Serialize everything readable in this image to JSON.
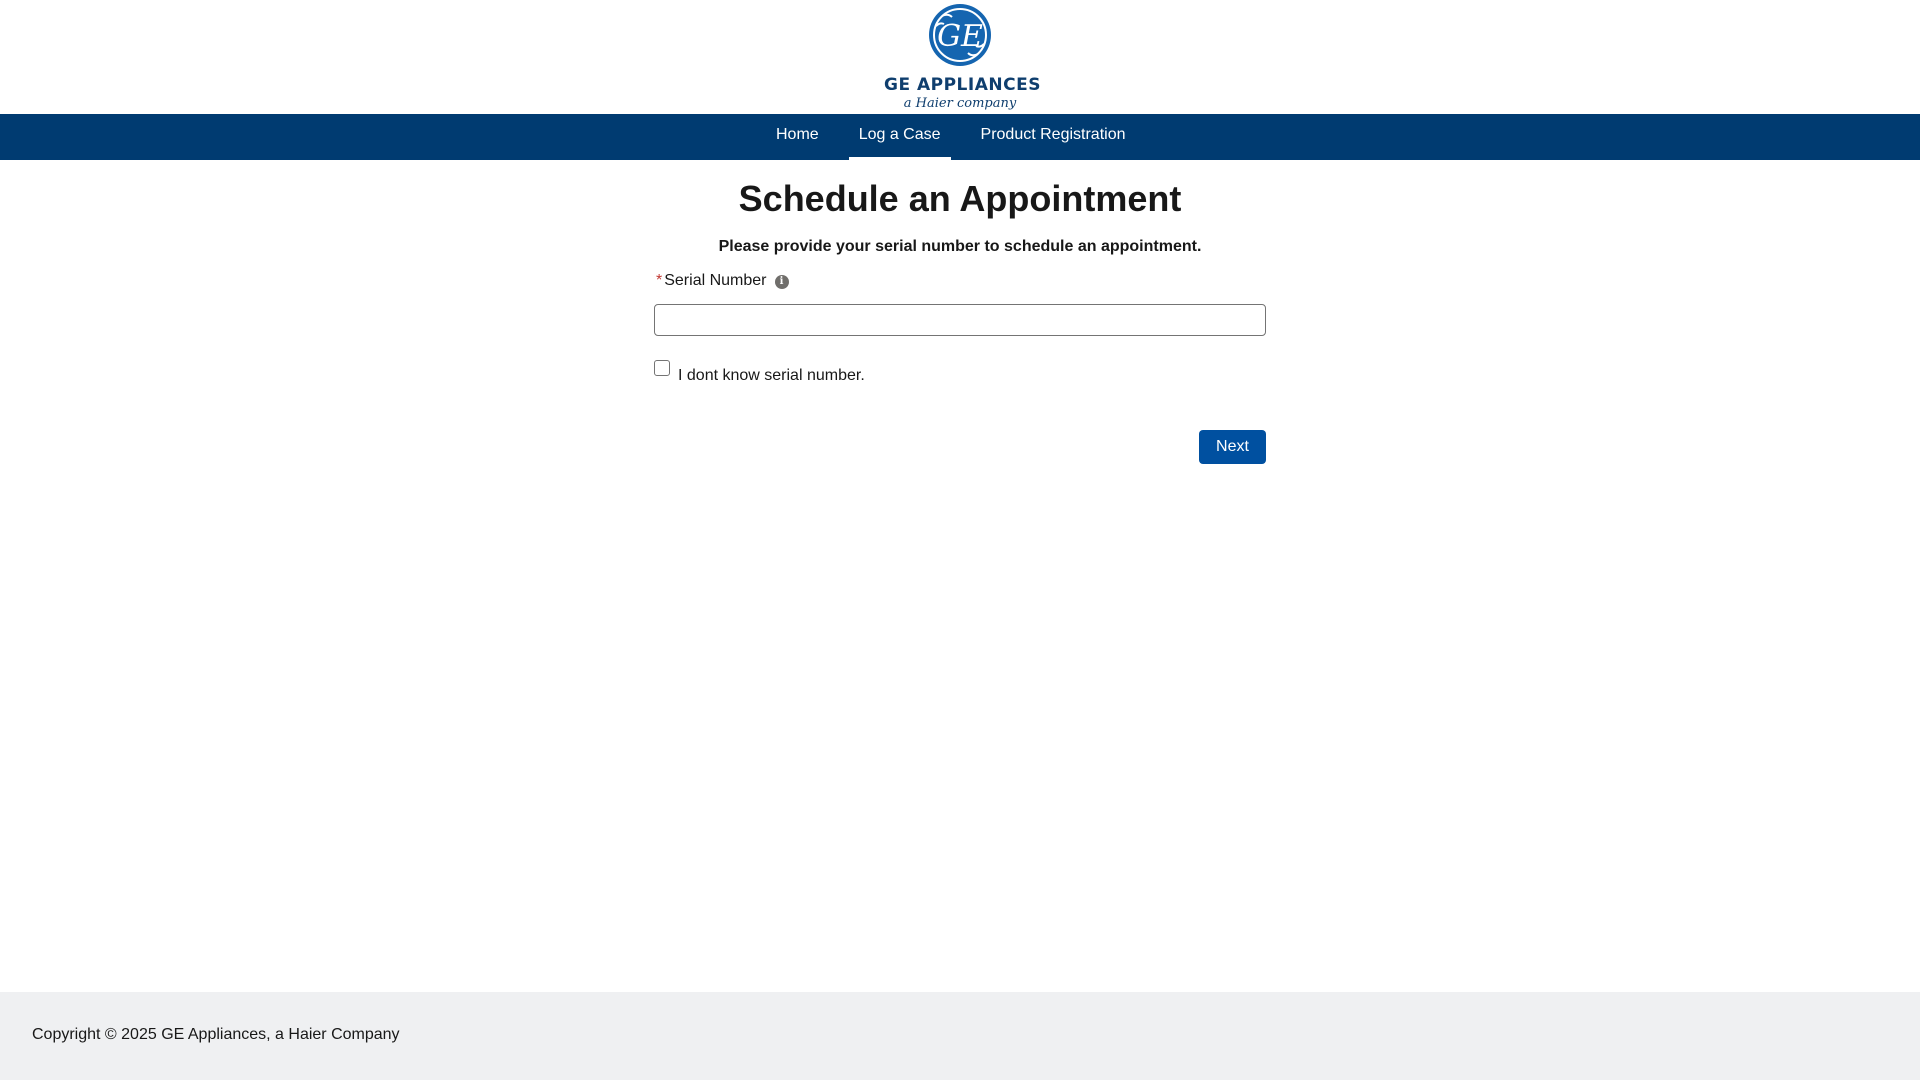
{
  "brand": {
    "logo_monogram": "GE",
    "logo_title": "GE APPLIANCES",
    "logo_subtitle": "a Haier company",
    "primary_color": "#003b71",
    "button_color": "#0050a0"
  },
  "nav": {
    "items": [
      {
        "label": "Home",
        "active": false
      },
      {
        "label": "Log a Case",
        "active": true
      },
      {
        "label": "Product Registration",
        "active": false
      }
    ]
  },
  "main": {
    "title": "Schedule an Appointment",
    "subtitle": "Please provide your serial number to schedule an appointment.",
    "serial_field": {
      "required_marker": "*",
      "label": "Serial Number",
      "info_icon": "info-icon",
      "value": "",
      "placeholder": ""
    },
    "unknown_serial_checkbox": {
      "label": "I dont know serial number.",
      "checked": false
    },
    "next_label": "Next"
  },
  "footer": {
    "copyright": "Copyright © 2025 GE Appliances, a Haier Company"
  }
}
